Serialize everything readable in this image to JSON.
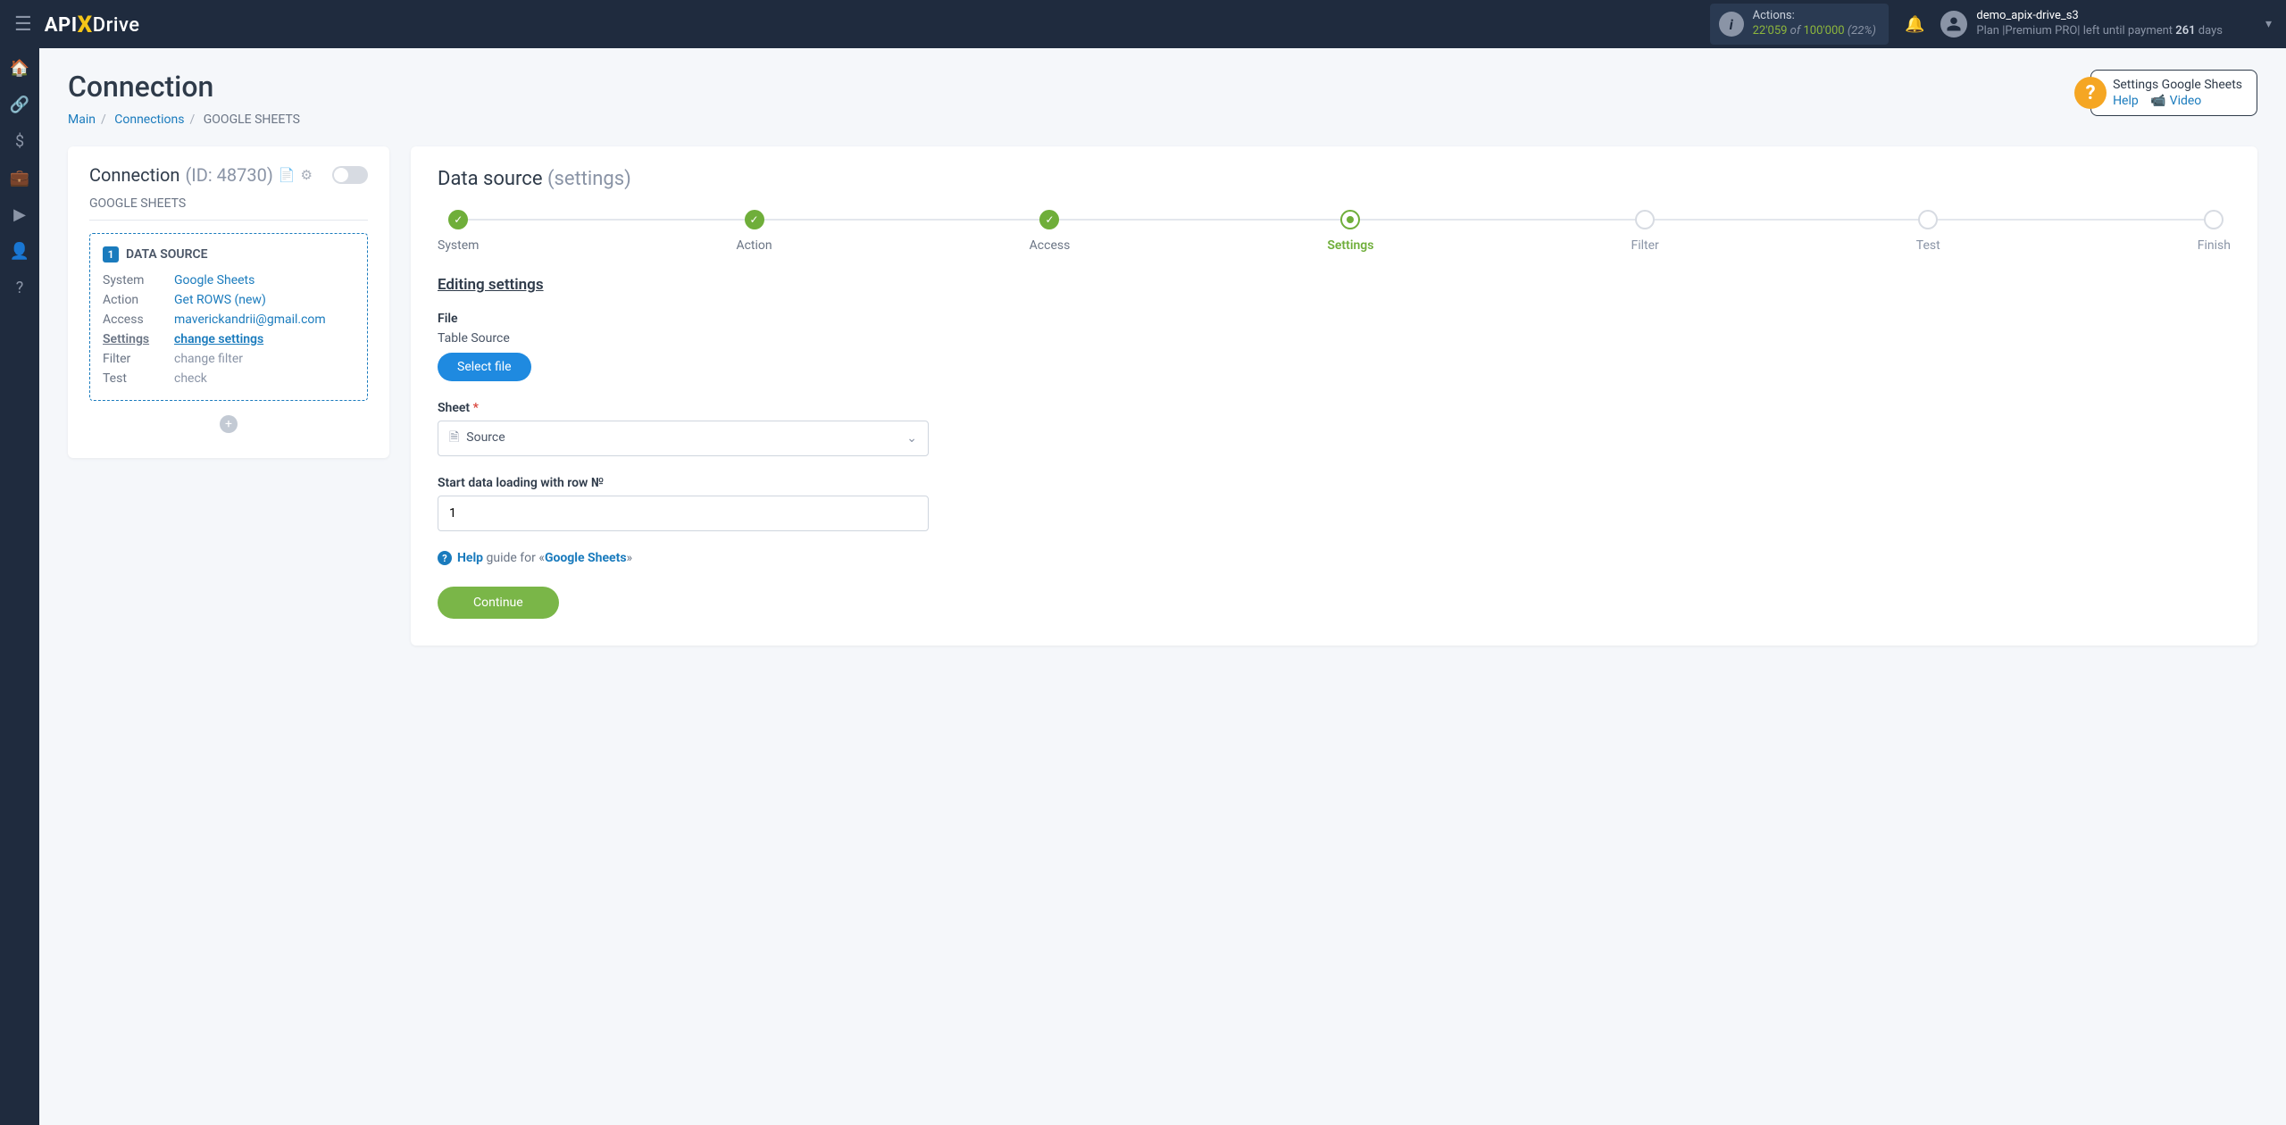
{
  "topbar": {
    "logo_api": "API",
    "logo_drive": "Drive",
    "actions": {
      "label": "Actions:",
      "used": "22'059",
      "of": "of",
      "total": "100'000",
      "percent": "(22%)"
    },
    "user": {
      "name": "demo_apix-drive_s3",
      "plan_prefix": "Plan ",
      "plan_name": "|Premium PRO|",
      "plan_mid": " left until payment ",
      "plan_days": "261",
      "plan_suffix": " days"
    }
  },
  "page": {
    "title": "Connection",
    "crumbs": {
      "main": "Main",
      "connections": "Connections",
      "current": "GOOGLE SHEETS"
    }
  },
  "help_widget": {
    "title": "Settings Google Sheets",
    "help": "Help",
    "video": "Video"
  },
  "left": {
    "head": "Connection",
    "id_label": "(ID: 48730)",
    "sub": "GOOGLE SHEETS",
    "source_num": "1",
    "source_title": "DATA SOURCE",
    "rows": {
      "system_k": "System",
      "system_v": "Google Sheets",
      "action_k": "Action",
      "action_v": "Get ROWS (new)",
      "access_k": "Access",
      "access_v": "maverickandrii@gmail.com",
      "settings_k": "Settings",
      "settings_v": "change settings",
      "filter_k": "Filter",
      "filter_v": "change filter",
      "test_k": "Test",
      "test_v": "check"
    }
  },
  "right": {
    "title": "Data source",
    "title_suffix": "(settings)",
    "steps": [
      "System",
      "Action",
      "Access",
      "Settings",
      "Filter",
      "Test",
      "Finish"
    ],
    "section": "Editing settings",
    "file": {
      "label": "File",
      "note": "Table Source",
      "button": "Select file"
    },
    "sheet": {
      "label": "Sheet",
      "value": "Source"
    },
    "row": {
      "label": "Start data loading with row №",
      "value": "1"
    },
    "helpline": {
      "help": "Help",
      "mid": "guide for «",
      "target": "Google Sheets",
      "end": "»"
    },
    "continue": "Continue"
  }
}
